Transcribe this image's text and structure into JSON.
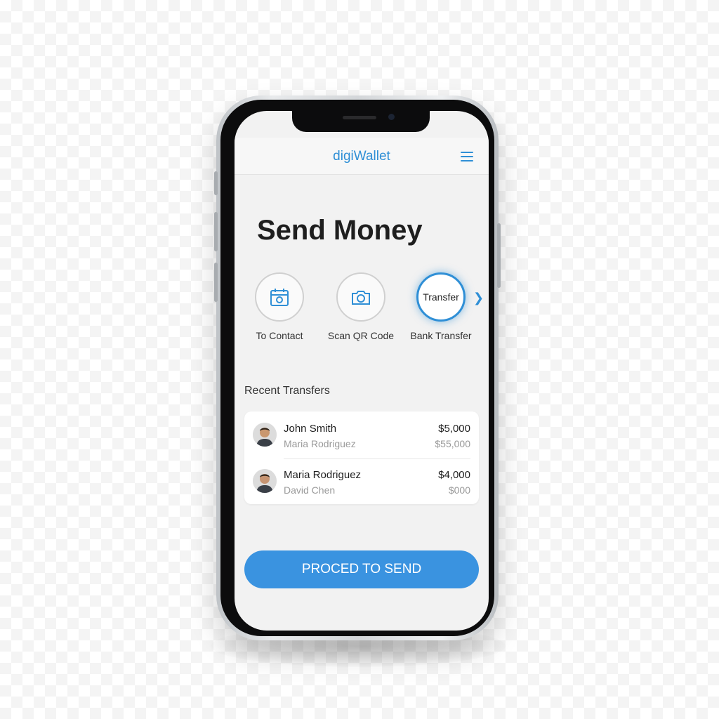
{
  "app": {
    "title": "digiWallet",
    "menu_icon": "hamburger-menu-icon",
    "accent_color": "#2f8fd6"
  },
  "page": {
    "title": "Send Money"
  },
  "options": [
    {
      "label": "To Contact",
      "icon": "calendar-icon",
      "selected": false
    },
    {
      "label": "Scan QR Code",
      "icon": "camera-icon",
      "selected": false
    },
    {
      "label": "Bank Transfer",
      "icon_text": "Transfer",
      "selected": true
    }
  ],
  "options_more_icon": "chevron-right-icon",
  "recent": {
    "title": "Recent Transfers",
    "items": [
      {
        "name": "John Smith",
        "sub": "Maria Rodriguez",
        "amount": "$5,000",
        "sub_amount": "$55,000"
      },
      {
        "name": "Maria Rodriguez",
        "sub": "David Chen",
        "amount": "$4,000",
        "sub_amount": "$000"
      }
    ]
  },
  "cta": {
    "label": "PROCED TO SEND",
    "color": "#3a93e0"
  }
}
